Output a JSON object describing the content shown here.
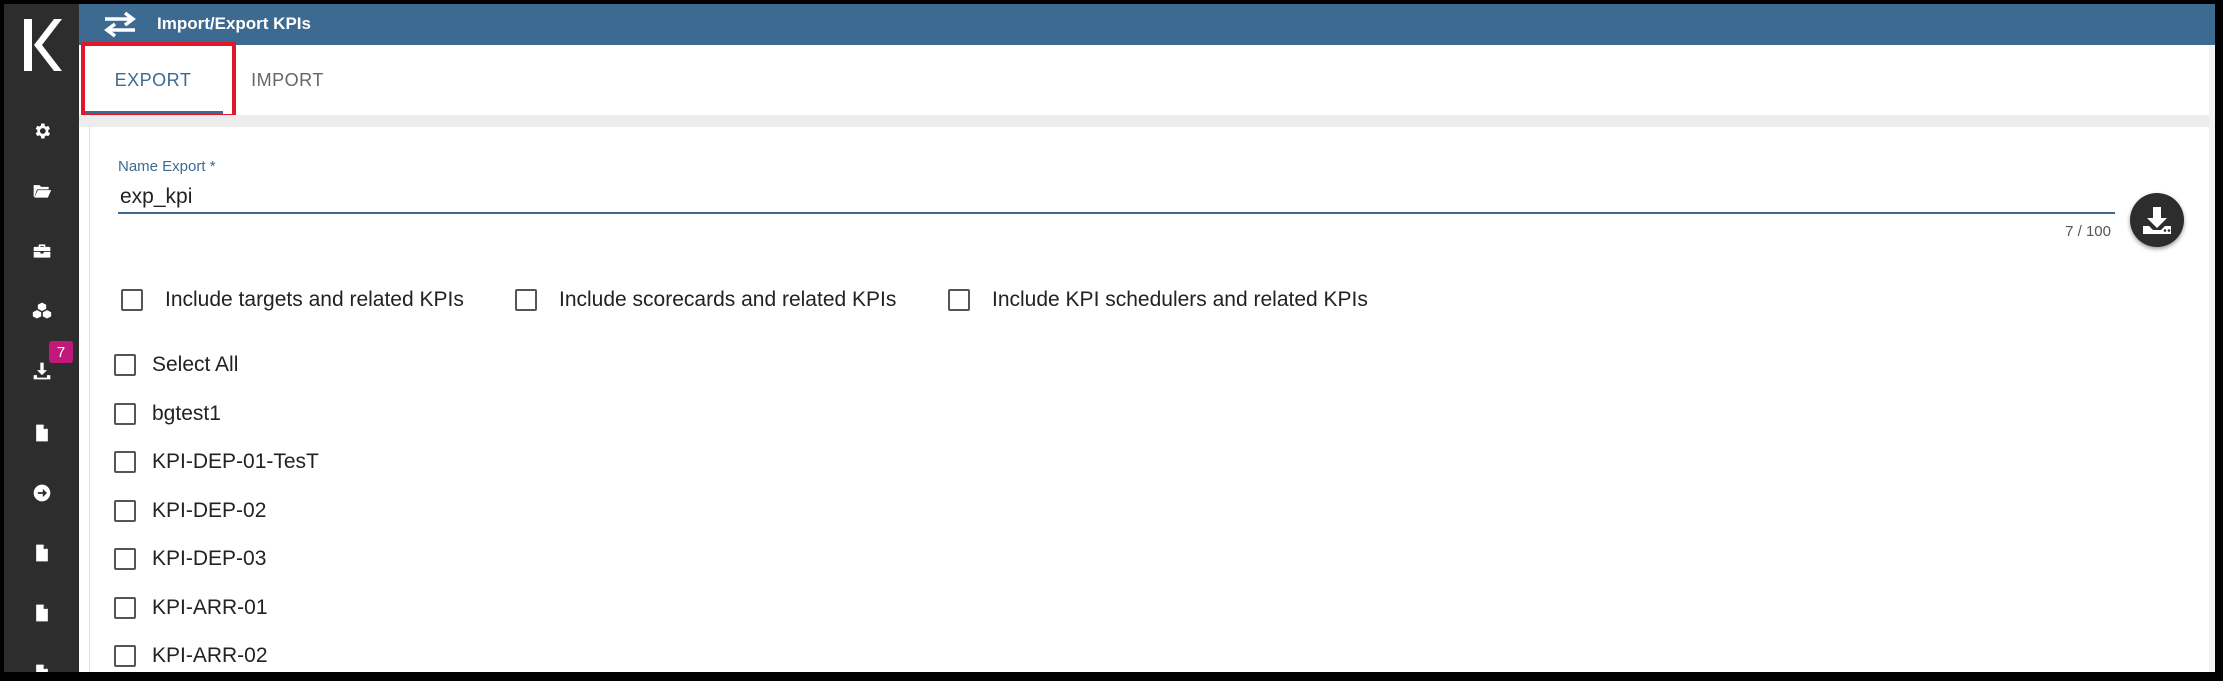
{
  "header": {
    "title": "Import/Export KPIs",
    "icon": "swap-arrows-icon"
  },
  "sidebar": {
    "logo": "K",
    "items": [
      {
        "name": "settings",
        "icon": "gear-icon"
      },
      {
        "name": "folder",
        "icon": "folder-open-icon"
      },
      {
        "name": "briefcase",
        "icon": "briefcase-icon"
      },
      {
        "name": "cubes",
        "icon": "cubes-icon"
      },
      {
        "name": "download",
        "icon": "download-icon",
        "badge": "7"
      },
      {
        "name": "document-1",
        "icon": "document-icon"
      },
      {
        "name": "arrow",
        "icon": "arrow-circle-right-icon"
      },
      {
        "name": "document-2",
        "icon": "document-icon"
      },
      {
        "name": "document-3",
        "icon": "document-icon"
      },
      {
        "name": "document-4",
        "icon": "document-icon"
      }
    ]
  },
  "tabs": [
    {
      "label": "EXPORT",
      "active": true
    },
    {
      "label": "IMPORT",
      "active": false
    }
  ],
  "form": {
    "name_label": "Name Export",
    "required_mark": "*",
    "name_value": "exp_kpi",
    "counter": "7 / 100"
  },
  "options": [
    {
      "label": "Include targets and related KPIs",
      "checked": false
    },
    {
      "label": "Include scorecards and related KPIs",
      "checked": false
    },
    {
      "label": "Include KPI schedulers and related KPIs",
      "checked": false
    }
  ],
  "select_all": {
    "label": "Select All",
    "checked": false
  },
  "kpis": [
    {
      "label": "bgtest1",
      "checked": false
    },
    {
      "label": "KPI-DEP-01-TesT",
      "checked": false
    },
    {
      "label": "KPI-DEP-02",
      "checked": false
    },
    {
      "label": "KPI-DEP-03",
      "checked": false
    },
    {
      "label": "KPI-ARR-01",
      "checked": false
    },
    {
      "label": "KPI-ARR-02",
      "checked": false
    }
  ],
  "colors": {
    "accent": "#3d6a91",
    "sidebar": "#2d2d2d",
    "badge": "#c2187a",
    "highlight": "#e0182b"
  }
}
